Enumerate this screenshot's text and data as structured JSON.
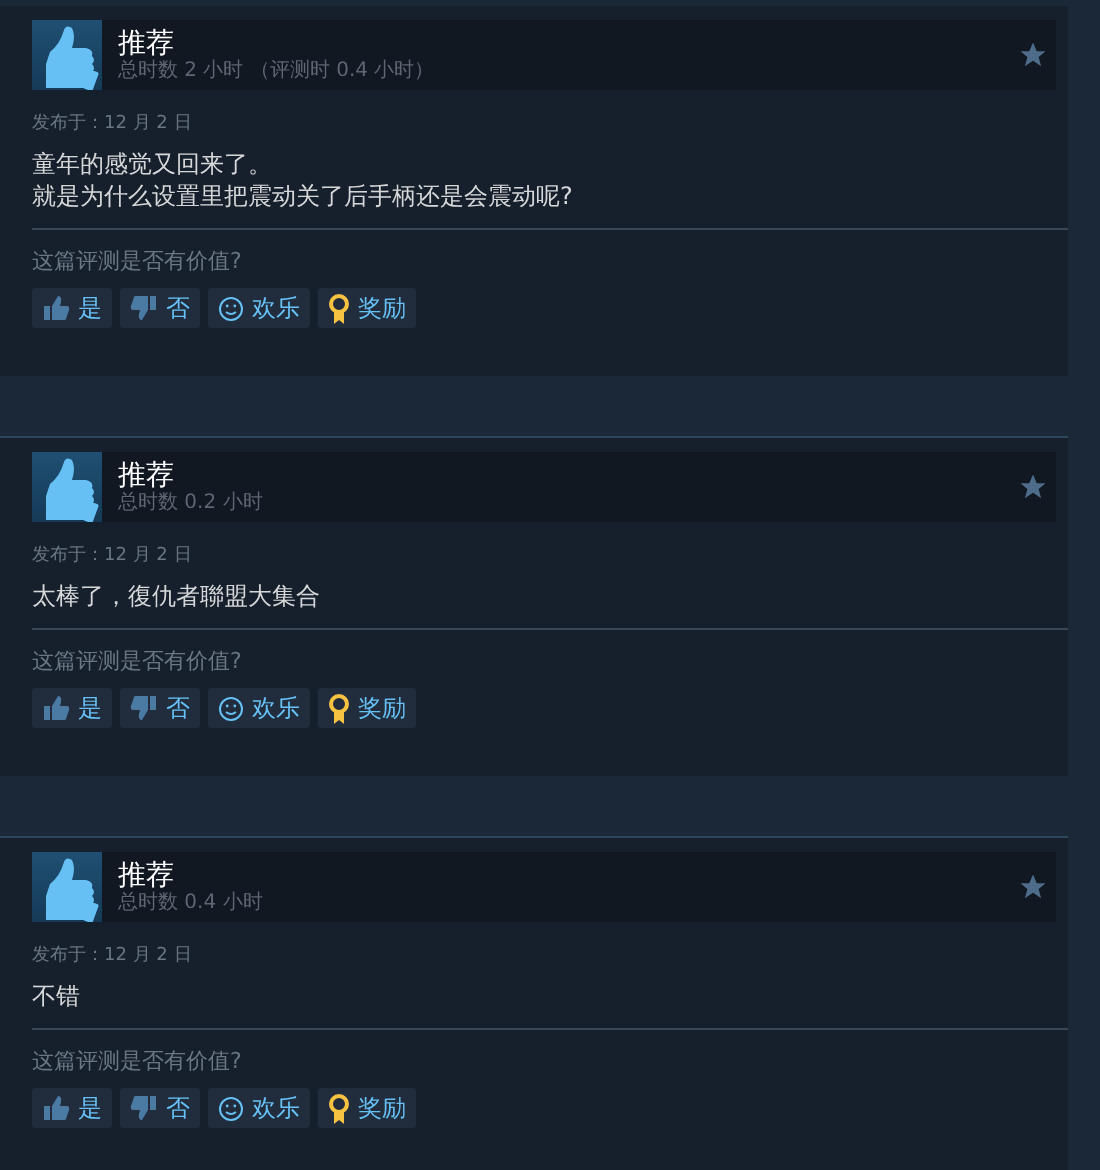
{
  "reviews": [
    {
      "recommended": true,
      "title": "推荐",
      "hours": "总时数 2 小时 （评测时 0.4 小时）",
      "posted": "发布于：12 月 2 日",
      "body": [
        "童年的感觉又回来了。",
        "就是为什么设置里把震动关了后手柄还是会震动呢?"
      ],
      "prompt": "这篇评测是否有价值?",
      "buttons": [
        {
          "kind": "yes",
          "label": "是"
        },
        {
          "kind": "no",
          "label": "否"
        },
        {
          "kind": "funny",
          "label": "欢乐"
        },
        {
          "kind": "award",
          "label": "奖励"
        }
      ]
    },
    {
      "recommended": true,
      "title": "推荐",
      "hours": "总时数 0.2 小时",
      "posted": "发布于：12 月 2 日",
      "body": [
        "太棒了，復仇者聯盟大集合"
      ],
      "prompt": "这篇评测是否有价值?",
      "buttons": [
        {
          "kind": "yes",
          "label": "是"
        },
        {
          "kind": "no",
          "label": "否"
        },
        {
          "kind": "funny",
          "label": "欢乐"
        },
        {
          "kind": "award",
          "label": "奖励"
        }
      ]
    },
    {
      "recommended": true,
      "title": "推荐",
      "hours": "总时数 0.4 小时",
      "posted": "发布于：12 月 2 日",
      "body": [
        "不错"
      ],
      "prompt": "这篇评测是否有价值?",
      "buttons": [
        {
          "kind": "yes",
          "label": "是"
        },
        {
          "kind": "no",
          "label": "否"
        },
        {
          "kind": "funny",
          "label": "欢乐"
        },
        {
          "kind": "award",
          "label": "奖励"
        }
      ]
    }
  ]
}
